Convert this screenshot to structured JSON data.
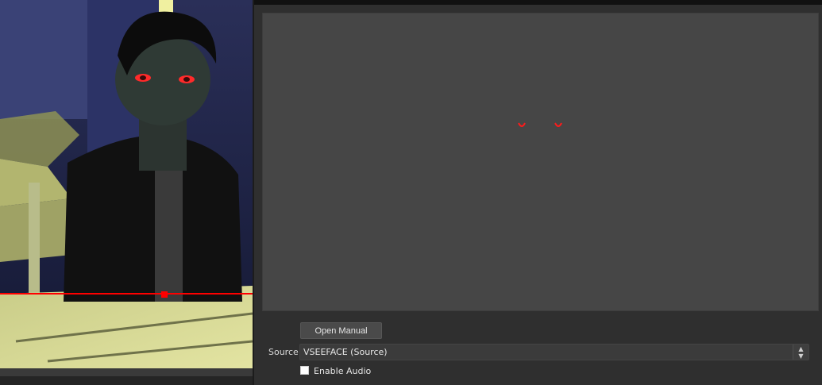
{
  "preview": {
    "scene": "vtuber-avatar-preview"
  },
  "filter": {
    "open_manual_label": "Open Manual",
    "source_label": "Source",
    "source_value": "VSEEFACE (Source)",
    "enable_audio_label": "Enable Audio",
    "enable_audio_checked": false
  },
  "colors": {
    "panel_bg": "#2f2f2f",
    "preview_bg": "#464646",
    "accent_red": "#ff1a1a"
  },
  "icons": {
    "select_arrow": "chevron-up-down-icon"
  }
}
